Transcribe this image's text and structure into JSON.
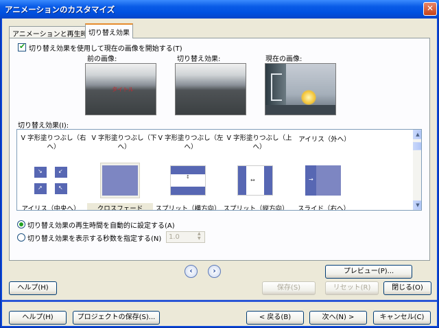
{
  "window": {
    "title": "アニメーションのカスタマイズ",
    "close_glyph": "✕"
  },
  "tabs": [
    {
      "label": "アニメーションと再生時間"
    },
    {
      "label": "切り替え効果"
    }
  ],
  "options": {
    "use_current_image_label": "切り替え効果を使用して現在の画像を開始する(T)",
    "use_current_image_checked": true
  },
  "previews": {
    "previous_label": "前の画像:",
    "previous_overlay_text": "タイトル",
    "effect_label": "切り替え効果:",
    "current_label": "現在の画像:"
  },
  "effects": {
    "list_label": "切り替え効果(I):",
    "top_row": [
      "V 字形塗りつぶし（右へ）",
      "V 字形塗りつぶし（下へ）",
      "V 字形塗りつぶし（左へ）",
      "V 字形塗りつぶし（上へ）",
      "アイリス（外へ）"
    ],
    "items": [
      {
        "name": "アイリス（中央へ）",
        "icon": "iris-in-icon"
      },
      {
        "name": "クロスフェード",
        "icon": "crossfade-icon",
        "selected": true
      },
      {
        "name": "スプリット（横方向）",
        "icon": "split-horizontal-icon"
      },
      {
        "name": "スプリット（縦方向）",
        "icon": "split-vertical-icon"
      },
      {
        "name": "スライド（右へ）",
        "icon": "slide-right-icon"
      }
    ]
  },
  "timing": {
    "auto_label": "切り替え効果の再生時間を自動的に設定する(A)",
    "auto_selected": true,
    "manual_label": "切り替え効果を表示する秒数を指定する(N)",
    "seconds_value": "1.0"
  },
  "buttons": {
    "preview": "プレビュー(P)...",
    "save": "保存(S)",
    "reset": "リセット(R)",
    "close": "閉じる(O)",
    "help_inner": "ヘルプ(H)",
    "help": "ヘルプ(H)",
    "save_project": "プロジェクトの保存(S)...",
    "back": "< 戻る(B)",
    "next": "次へ(N) >",
    "cancel": "キャンセル(C)",
    "prev_glyph": "‹",
    "next_glyph": "›"
  },
  "colors": {
    "title_bar": "#0054e3",
    "dialog_bg": "#ece9d8",
    "selection_accent": "#e68b2c",
    "effect_blue": "#5767b3"
  }
}
